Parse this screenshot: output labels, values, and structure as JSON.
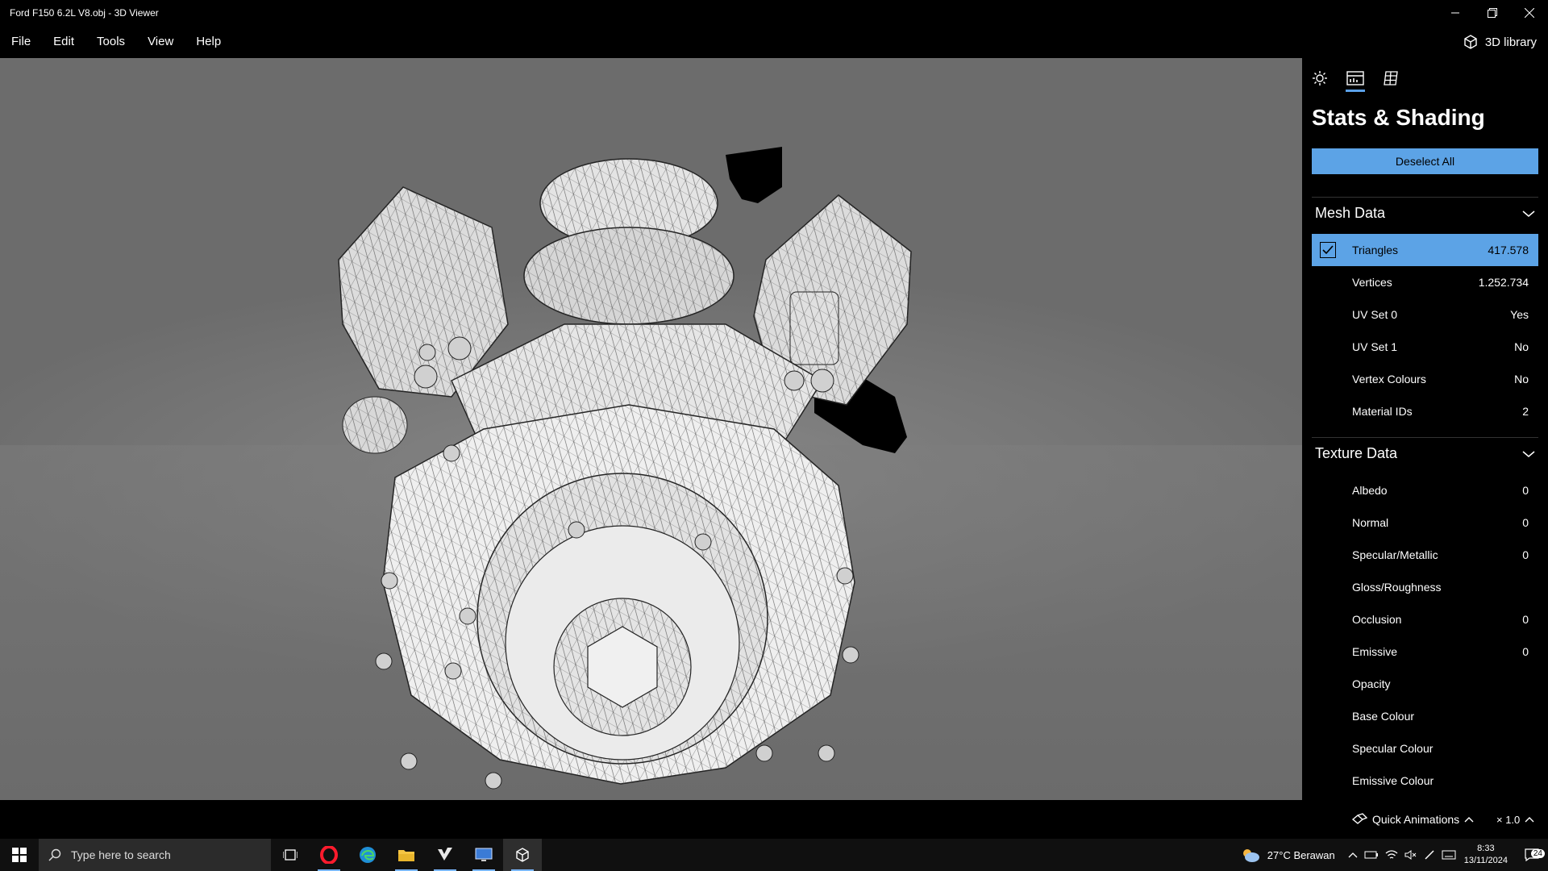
{
  "window": {
    "title": "Ford F150 6.2L V8.obj - 3D Viewer"
  },
  "menu": {
    "items": [
      "File",
      "Edit",
      "Tools",
      "View",
      "Help"
    ],
    "library_label": "3D library"
  },
  "panel": {
    "title": "Stats & Shading",
    "deselect_label": "Deselect All",
    "mesh": {
      "heading": "Mesh Data",
      "rows": [
        {
          "name": "Triangles",
          "value": "417.578",
          "selected": true
        },
        {
          "name": "Vertices",
          "value": "1.252.734"
        },
        {
          "name": "UV Set 0",
          "value": "Yes"
        },
        {
          "name": "UV Set 1",
          "value": "No"
        },
        {
          "name": "Vertex Colours",
          "value": "No"
        },
        {
          "name": "Material IDs",
          "value": "2"
        }
      ]
    },
    "texture": {
      "heading": "Texture Data",
      "rows": [
        {
          "name": "Albedo",
          "value": "0"
        },
        {
          "name": "Normal",
          "value": "0"
        },
        {
          "name": "Specular/Metallic",
          "value": "0"
        },
        {
          "name": "Gloss/Roughness",
          "value": ""
        },
        {
          "name": "Occlusion",
          "value": "0"
        },
        {
          "name": "Emissive",
          "value": "0"
        },
        {
          "name": "Opacity",
          "value": ""
        },
        {
          "name": "Base Colour",
          "value": ""
        },
        {
          "name": "Specular Colour",
          "value": ""
        },
        {
          "name": "Emissive Colour",
          "value": ""
        }
      ]
    },
    "accent": "#5ca3e6"
  },
  "status": {
    "quick_animations": "Quick Animations",
    "speed": "× 1.0"
  },
  "taskbar": {
    "search_placeholder": "Type here to search",
    "weather": "27°C  Berawan",
    "time": "8:33",
    "date": "13/11/2024",
    "notifications": "24"
  }
}
